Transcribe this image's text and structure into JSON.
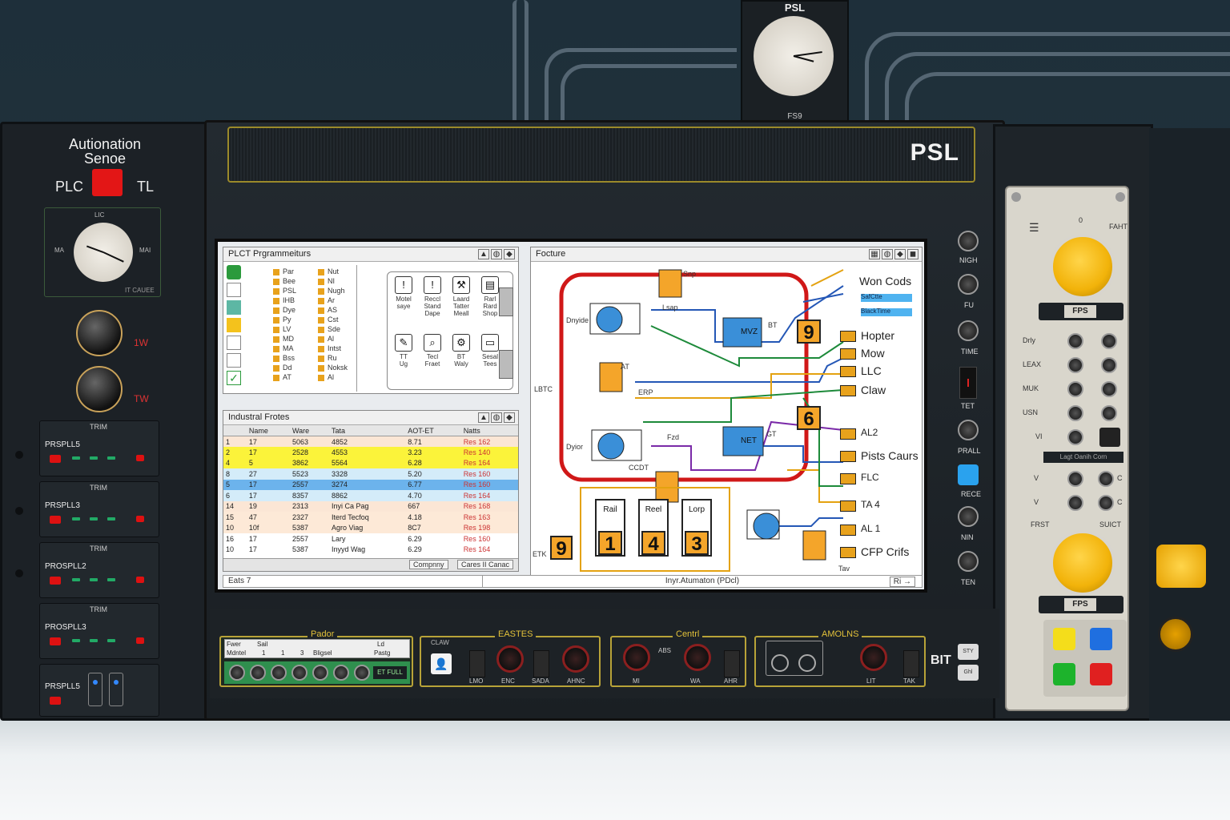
{
  "brand": {
    "logo": "PSL",
    "top_logo": "PSL",
    "top_small": "FS9"
  },
  "left_panel": {
    "title_line1": "Autionation",
    "title_line2": "Senoe",
    "plc_label": "PLC",
    "tl_label": "TL",
    "gauge_top": "LIC",
    "gauge_left": "MA",
    "gauge_right": "MAI",
    "gauge_bottom": "IT CAUEE",
    "knob1_label": "1W",
    "knob2_label": "TW",
    "trim_label": "TRIM",
    "modules": [
      "PRSPLL5",
      "PRSPLL3",
      "PROSPLL2",
      "PROSPLL3",
      "PRSPLL5"
    ]
  },
  "screen": {
    "window1": {
      "title": "PLCT Prgrammeiturs",
      "tree_col1": [
        "Par",
        "Bee",
        "PSL",
        "IHB",
        "Dye",
        "Py",
        "LV",
        "MD",
        "MA",
        "Bss",
        "Dd",
        "AT"
      ],
      "tree_col2": [
        "Nut",
        "NI",
        "Nugh",
        "Ar",
        "AS",
        "Cst",
        "Sde",
        "Al",
        "Intst",
        "Ru",
        "Noksk",
        "Al"
      ],
      "tools": [
        {
          "label": "Motel\nsaye"
        },
        {
          "label": "Reccl\nStand\nDape"
        },
        {
          "label": "Laard\nTatter\nMeall"
        },
        {
          "label": "Rarl\nRard\nShop"
        },
        {
          "label": "TT\nUg"
        },
        {
          "label": "Tecl\nFraet"
        },
        {
          "label": "BT\nWaly"
        },
        {
          "label": "Sesal\nTees"
        }
      ]
    },
    "window2": {
      "title": "Industral Frotes",
      "columns": [
        "",
        "Name",
        "Ware",
        "Tata",
        "AOT-ET",
        "Natts"
      ],
      "rows": [
        [
          "1",
          "17",
          "5063",
          "4852",
          "8.71",
          "Res 162"
        ],
        [
          "2",
          "17",
          "2528",
          "4553",
          "3.23",
          "Res 140"
        ],
        [
          "4",
          "5",
          "3862",
          "5564",
          "6.28",
          "Res 164"
        ],
        [
          "8",
          "27",
          "5523",
          "3328",
          "5.20",
          "Res 160"
        ],
        [
          "5",
          "17",
          "2557",
          "3274",
          "6.77",
          "Res 160"
        ],
        [
          "6",
          "17",
          "8357",
          "8862",
          "4.70",
          "Res 164"
        ],
        [
          "14",
          "19",
          "2313",
          "Inyi Ca Pag",
          "667",
          "Res 168"
        ],
        [
          "15",
          "47",
          "2327",
          "Iterd Tecfoq",
          "4.18",
          "Res 163"
        ],
        [
          "10",
          "10f",
          "5387",
          "Agro Viag",
          "8C7",
          "Res 198"
        ],
        [
          "16",
          "17",
          "2557",
          "Lary",
          "6.29",
          "Res 160"
        ],
        [
          "10",
          "17",
          "5387",
          "Inyyd Wag",
          "6.29",
          "Res 164"
        ]
      ],
      "row_colors": [
        "#fbe6d5",
        "#fbf33a",
        "#fbf33a",
        "#d4ecf9",
        "#6cb3ec",
        "#d4ecf9",
        "#fbe6d5",
        "#fde9d7",
        "#fde9d7",
        "#ffffff",
        "#ffffff"
      ],
      "buttons": [
        "Compnny",
        "Cares II Canac"
      ]
    },
    "window3": {
      "title": "Focture",
      "labels_right": [
        "Won Cods",
        "Hopter",
        "Mow",
        "LLC",
        "Claw",
        "AL2",
        "Pists Caurs",
        "FLC",
        "TA 4",
        "AL 1",
        "CFP Crifs"
      ],
      "blue_tags": [
        "SafCtte",
        "BlackTime"
      ],
      "blocks": [
        {
          "text": "9"
        },
        {
          "text": "6"
        },
        {
          "text": "9"
        },
        {
          "text": "1",
          "label": "Rail"
        },
        {
          "text": "4",
          "label": "Reel"
        },
        {
          "text": "3",
          "label": "Lorp"
        }
      ],
      "small_labels": [
        "Snp",
        "Lsap",
        "Dnyide",
        "Dyior",
        "LBTC",
        "MVZ",
        "NET",
        "BT",
        "GT",
        "AT",
        "ERP",
        "Fzd",
        "CCDT",
        "Tav",
        "ETK"
      ]
    },
    "status_left": "Eats 7",
    "status_center": "Inyr.Atumaton (PDcl)",
    "status_right": "Ri"
  },
  "bottom": {
    "module1_title": "Pador",
    "module1_cols": [
      "Fwer",
      "Sail",
      "Ld"
    ],
    "module1_row": [
      "Mdntel",
      "1",
      "1",
      "3",
      "Bligsel",
      "Pastg"
    ],
    "module1_btn": "ET FULL",
    "module2_title": "EASTES",
    "module2_label": "CLAW",
    "module2_knobs": [
      "LMO",
      "ENC",
      "SADA",
      "AHNC"
    ],
    "module3_title": "Centrl",
    "module3_knobs": [
      "MI",
      "ABS",
      "WA",
      "AHR"
    ],
    "module4_title": "AMOLNS",
    "module4_knobs": [
      "LIT",
      "TAK"
    ],
    "bit_label": "BIT",
    "side_btns": [
      "STY",
      "Ghl"
    ]
  },
  "right_controls": {
    "labels": [
      "NIGH",
      "FU",
      "TIME",
      "TET",
      "PRALL",
      "RECE",
      "NIN",
      "TEN"
    ],
    "panel": {
      "top": "0",
      "fart": "FAHT",
      "fps1": "FPS",
      "rows": [
        "Drly",
        "LEAX",
        "MUK",
        "USN",
        "VI"
      ],
      "caption": "Lagt Oanih Corn",
      "v_labels": [
        "V",
        "V"
      ],
      "c_labels": [
        "C",
        "C"
      ],
      "frst": "FRST",
      "suict": "SUICT",
      "fps2": "FPS",
      "squares": [
        "#f4dd1b",
        "#1f6fe0",
        "#1db32c",
        "#e02020"
      ]
    }
  },
  "colors": {
    "accent_orange": "#f4a52a",
    "wire_red": "#d01818",
    "screen_bg": "#e9ecef"
  }
}
